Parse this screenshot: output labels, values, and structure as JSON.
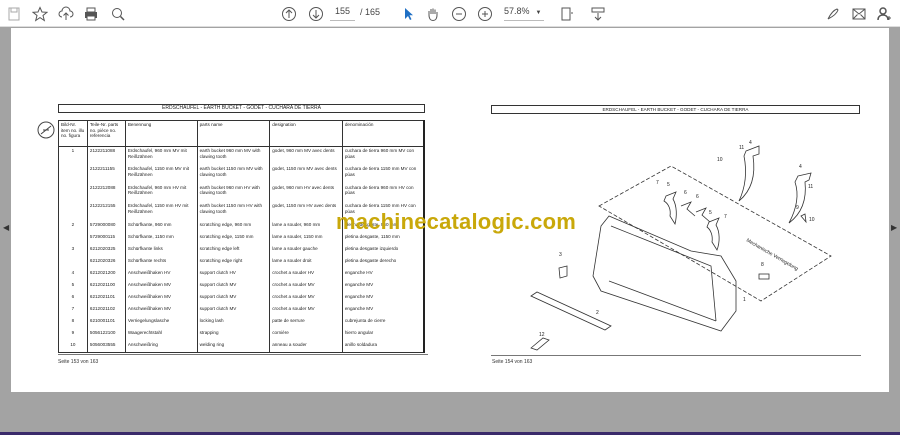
{
  "toolbar": {
    "current_page": "155",
    "total_pages": "/ 165",
    "zoom": "57.8%",
    "icons": [
      "save-icon",
      "bookmark-star-icon",
      "upload-cloud-icon",
      "print-icon",
      "search-zoom-icon",
      "page-up-icon",
      "page-down-icon",
      "select-cursor-icon",
      "hand-pan-icon",
      "zoom-out-icon",
      "zoom-in-icon",
      "fit-page-icon",
      "scroll-mode-icon",
      "sign-icon",
      "email-icon",
      "account-icon"
    ]
  },
  "left_page": {
    "title": "ERDSCHAUFEL - EARTH BUCKET - GODET - CUCHARA DE TIERRA",
    "headers": [
      "Bild-Nr. item no. illu no. figura",
      "Teile-Nr. parts no. pièce no. referencia",
      "Benennung",
      "parts name",
      "designation",
      "denominación"
    ],
    "rows": [
      [
        "1",
        "2122211088",
        "Erdschaufel, 960 mm MV mit Reißzähnen",
        "earth bucket 960 mm MV with clawing tooth",
        "godet, 960 mm MV avec dents",
        "cuchara de tierra 960 mm MV con púas"
      ],
      [
        "",
        "2122211155",
        "Erdschaufel, 1150 mm MV mit Reißzähnen",
        "earth bucket 1150 mm MV with clawing tooth",
        "godet, 1150 mm MV avec dents",
        "cuchara de tierra 1150 mm MV con púas"
      ],
      [
        "",
        "2122212088",
        "Erdschaufel, 960 mm HV mit Reißzähnen",
        "earth bucket 960 mm HV with clawing tooth",
        "godet, 960 mm HV avec dents",
        "cuchara de tierra 960 mm HV con púas"
      ],
      [
        "",
        "2122212155",
        "Erdschaufel, 1150 mm HV mit Reißzähnen",
        "earth bucket 1150 mm HV with clawing tooth",
        "godet, 1150 mm HV avec dents",
        "cuchara de tierra 1150 mm HV con púas"
      ],
      [
        "2",
        "5729000080",
        "Schürfkante, 960 mm",
        "scratching edge, 960 mm",
        "lame a souder, 960 mm",
        "pletina desgaste, 960 mm"
      ],
      [
        "",
        "5729000115",
        "Schürfkante, 1150 mm",
        "scratching edge, 1150 mm",
        "lame a souder, 1150 mm",
        "pletina desgaste, 1150 mm"
      ],
      [
        "3",
        "6212020325",
        "Schürfkante links",
        "scratching edge left",
        "lame a souder gauche",
        "pletina desgaste izquierdo"
      ],
      [
        "",
        "6212020326",
        "Schürfkante rechts",
        "scratching edge right",
        "lame a souder droit",
        "pletina desgaste derecho"
      ],
      [
        "4",
        "6212021200",
        "Anschweißhaken HV",
        "support clutch HV",
        "crochet a souder HV",
        "enganche HV"
      ],
      [
        "5",
        "6212021100",
        "Anschweißhaken MV",
        "support clutch MV",
        "crochet a souder MV",
        "enganche MV"
      ],
      [
        "6",
        "6212021101",
        "Anschweißhaken MV",
        "support clutch MV",
        "crochet a souder MV",
        "enganche MV"
      ],
      [
        "7",
        "6212021102",
        "Anschweißhaken MV",
        "support clutch MV",
        "crochet a souder MV",
        "enganche MV"
      ],
      [
        "8",
        "6210001101",
        "Verriegelungslasche",
        "locking lash",
        "patte de serrure",
        "cubrejunta de cierre"
      ],
      [
        "9",
        "5056122100",
        "Waagerechtstahl",
        "strapping",
        "cornière",
        "hierro angular"
      ],
      [
        "10",
        "5056003555",
        "Anschweißring",
        "welding ring",
        "anneau a souder",
        "anillo soldadura"
      ]
    ],
    "footer": "Seite 153 von 163"
  },
  "right_page": {
    "title": "ERDSCHAUFEL - EARTH BUCKET - GODET - CUCHARA DE TIERRA",
    "callouts": [
      "11",
      "4",
      "10",
      "4",
      "11",
      "10",
      "7",
      "5",
      "6",
      "6",
      "5",
      "7",
      "9",
      "8",
      "1",
      "2",
      "3",
      "12"
    ],
    "diagram_note": "Mechanische Verriegelung",
    "footer": "Seite 154 von 163"
  },
  "watermark": "machinecatalogic.com"
}
